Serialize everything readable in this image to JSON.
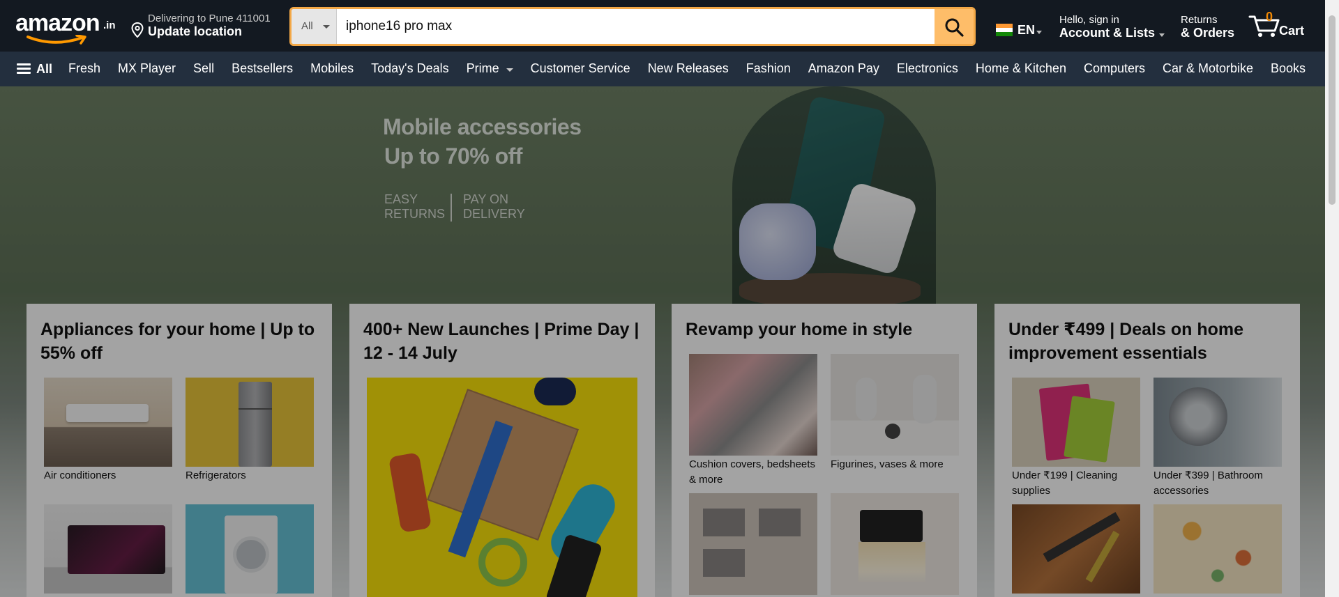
{
  "header": {
    "logo_text": "amazon",
    "logo_tld": ".in",
    "location_line1": "Delivering to Pune 411001",
    "location_line2": "Update location",
    "search": {
      "category": "All",
      "query": "iphone16 pro max"
    },
    "language": "EN",
    "account_line1": "Hello, sign in",
    "account_line2": "Account & Lists",
    "orders_line1": "Returns",
    "orders_line2": "& Orders",
    "cart_count": "0",
    "cart_label": "Cart"
  },
  "nav": {
    "all_label": "All",
    "links": [
      "Fresh",
      "MX Player",
      "Sell",
      "Bestsellers",
      "Mobiles",
      "Today's Deals",
      "Prime",
      "Customer Service",
      "New Releases",
      "Fashion",
      "Amazon Pay",
      "Electronics",
      "Home & Kitchen",
      "Computers",
      "Car & Motorbike",
      "Books"
    ]
  },
  "hero": {
    "title1": "Mobile accessories",
    "title2": "Up to 70% off",
    "badge1": "EASY RETURNS",
    "badge2": "PAY ON DELIVERY"
  },
  "cards": [
    {
      "title": "Appliances for your home | Up to 55% off",
      "tiles": [
        "Air conditioners",
        "Refrigerators",
        "",
        ""
      ]
    },
    {
      "title": "400+ New Launches | Prime Day | 12 - 14 July",
      "tiles": []
    },
    {
      "title": "Revamp your home in style",
      "tiles": [
        "Cushion covers, bedsheets & more",
        "Figurines, vases & more",
        "",
        ""
      ]
    },
    {
      "title": "Under ₹499 | Deals on home improvement essentials",
      "tiles": [
        "Under ₹199 | Cleaning supplies",
        "Under ₹399 | Bathroom accessories",
        "",
        ""
      ]
    }
  ],
  "colors": {
    "header_bg": "#131921",
    "nav_bg": "#232f3e",
    "search_button": "#febd69",
    "search_border": "#f3a847",
    "cart_count": "#f08804"
  }
}
